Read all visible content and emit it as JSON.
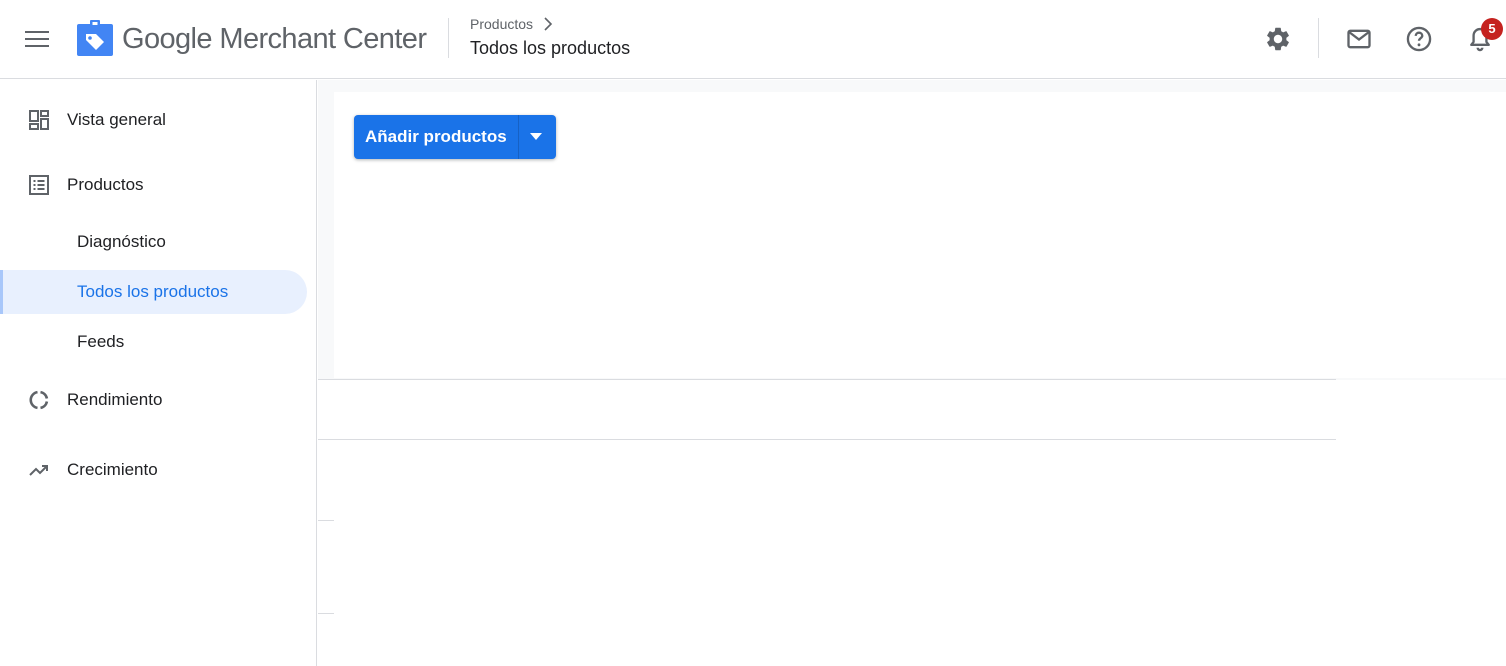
{
  "header": {
    "brand": {
      "google": "Google",
      "product": "Merchant Center"
    },
    "breadcrumb_parent": "Productos",
    "page_title": "Todos los productos",
    "notifications_count": "5",
    "icons": [
      "menu-icon",
      "merchant-center-logo",
      "settings-icon",
      "mail-icon",
      "help-icon",
      "notifications-icon"
    ]
  },
  "sidebar": {
    "items": [
      {
        "label": "Vista general",
        "icon": "dashboard-icon"
      },
      {
        "label": "Productos",
        "icon": "list-icon",
        "children": [
          {
            "label": "Diagnóstico"
          },
          {
            "label": "Todos los productos",
            "active": true
          },
          {
            "label": "Feeds"
          }
        ]
      },
      {
        "label": "Rendimiento",
        "icon": "donut-chart-icon"
      },
      {
        "label": "Crecimiento",
        "icon": "trending-up-icon"
      }
    ]
  },
  "main": {
    "add_button_label": "Añadir productos"
  },
  "colors": {
    "primary": "#1a73e8",
    "active_bg": "#e8f0fe",
    "badge": "#c5221f",
    "divider": "#dadce0"
  }
}
